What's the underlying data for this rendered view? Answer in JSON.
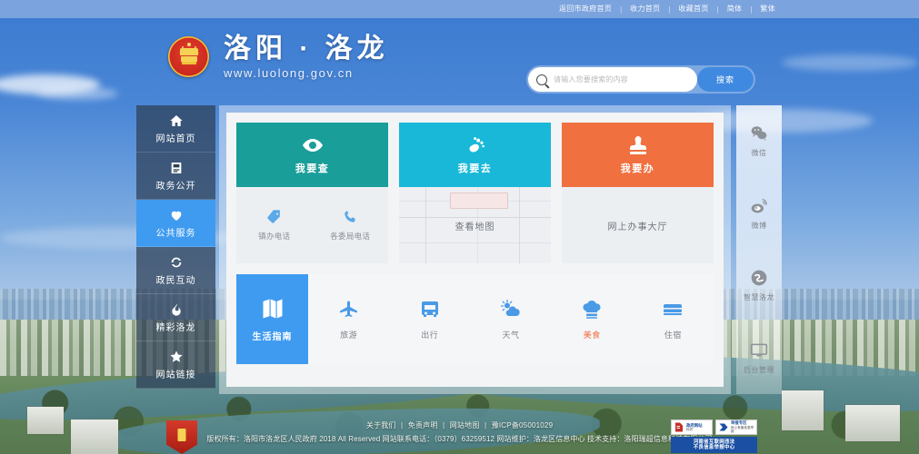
{
  "topbar": {
    "links": [
      "返回市政府首页",
      "收力首页",
      "收藏首页",
      "简体",
      "繁体"
    ],
    "separator": "|"
  },
  "header": {
    "emblem_icon": "national-emblem-icon",
    "brand_title": "洛阳 · 洛龙",
    "brand_url": "www.luolong.gov.cn",
    "search": {
      "icon": "search-icon",
      "placeholder": "请输入您要搜索的内容",
      "value": "",
      "button_label": "搜索"
    }
  },
  "sidebar": {
    "items": [
      {
        "label": "网站首页",
        "icon": "home-icon",
        "active": false
      },
      {
        "label": "政务公开",
        "icon": "document-icon",
        "active": false
      },
      {
        "label": "公共服务",
        "icon": "heart-icon",
        "active": true
      },
      {
        "label": "政民互动",
        "icon": "refresh-icon",
        "active": false
      },
      {
        "label": "精彩洛龙",
        "icon": "flame-icon",
        "active": false
      },
      {
        "label": "网站链接",
        "icon": "star-icon",
        "active": false
      }
    ]
  },
  "main": {
    "cards": [
      {
        "title": "我要查",
        "icon": "eye-icon",
        "color": "#1a9e99",
        "body_type": "links",
        "links": [
          {
            "label": "镇办电话",
            "icon": "tag-icon"
          },
          {
            "label": "各委局电话",
            "icon": "phone-icon"
          }
        ]
      },
      {
        "title": "我要去",
        "icon": "footprint-icon",
        "color": "#19b8d8",
        "body_type": "map",
        "center_label": "查看地图"
      },
      {
        "title": "我要办",
        "icon": "stamp-icon",
        "color": "#f0703f",
        "body_type": "plain",
        "center_label": "网上办事大厅"
      }
    ],
    "guide": {
      "main": {
        "label": "生活指南",
        "icon": "map-fold-icon"
      },
      "items": [
        {
          "label": "旅游",
          "icon": "airplane-icon",
          "highlight": false
        },
        {
          "label": "出行",
          "icon": "bus-icon",
          "highlight": false
        },
        {
          "label": "天气",
          "icon": "weather-icon",
          "highlight": false
        },
        {
          "label": "美食",
          "icon": "chef-hat-icon",
          "highlight": true
        },
        {
          "label": "住宿",
          "icon": "bed-icon",
          "highlight": false
        }
      ]
    }
  },
  "rightrail": {
    "items": [
      {
        "label": "微信",
        "icon": "wechat-icon"
      },
      {
        "label": "微博",
        "icon": "weibo-icon"
      },
      {
        "label": "智慧洛龙",
        "icon": "smart-city-icon"
      },
      {
        "label": "后台管理",
        "icon": "monitor-icon"
      }
    ]
  },
  "footer": {
    "links": [
      "关于我们",
      "免责声明",
      "网站地图",
      "豫ICP备05001029"
    ],
    "separator": "|",
    "copyright": "版权所有：洛阳市洛龙区人民政府 2018 All Reserved  网站联系电话：（0379）63259512  网站维护：洛龙区信息中心  技术支持：洛阳瑞超信息科技有限公司",
    "emblem_icon": "gov-shield-icon",
    "badges": [
      {
        "title": "政府网站",
        "subtitle": "标识"
      },
      {
        "title": "举报专区",
        "subtitle": "网上有害信息举报"
      }
    ],
    "report_banner_line1": "河南省互联网违法",
    "report_banner_line2": "不良信息举报中心"
  },
  "colors": {
    "accent_blue": "#3f9bf0",
    "topbar_blue": "#7ba3dd",
    "card_teal": "#1a9e99",
    "card_cyan": "#19b8d8",
    "card_orange": "#f0703f"
  }
}
